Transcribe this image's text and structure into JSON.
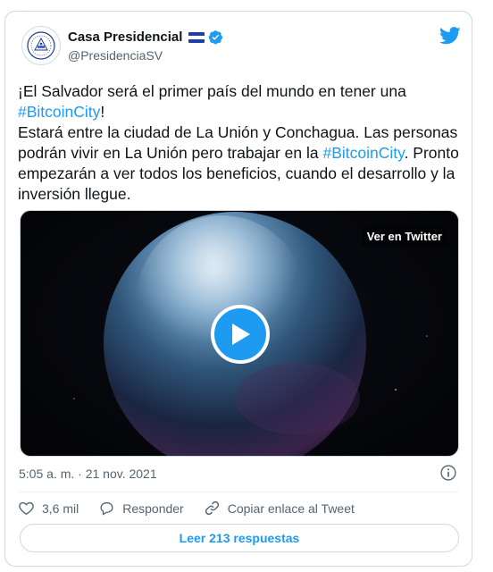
{
  "account": {
    "display_name": "Casa Presidencial",
    "handle": "@PresidenciaSV",
    "flag_icon": "el-salvador-flag-icon",
    "verified_icon": "verified-badge-icon",
    "verified_color": "#1d9bf0"
  },
  "tweet": {
    "part1": "¡El Salvador será el primer país del mundo en tener una ",
    "hashtag1": "#BitcoinCity",
    "part2": "!",
    "part3": "Estará entre la ciudad de La Unión y Conchagua. Las personas podrán vivir en La Unión pero trabajar en la ",
    "hashtag2": "#BitcoinCity",
    "part4": ". Pronto empezarán a ver todos los beneficios, cuando el desarrollo y la inversión llegue."
  },
  "media": {
    "overlay_label": "Ver en Twitter",
    "play_icon": "play-icon"
  },
  "meta": {
    "timestamp": "5:05 a. m. · 21 nov. 2021"
  },
  "actions": {
    "like_count": "3,6 mil",
    "reply_label": "Responder",
    "copy_label": "Copiar enlace al Tweet"
  },
  "replies_button": "Leer 213 respuestas",
  "colors": {
    "accent": "#1d9bf0",
    "text": "#0f1419",
    "secondary": "#536471",
    "border": "#cfd9de"
  }
}
